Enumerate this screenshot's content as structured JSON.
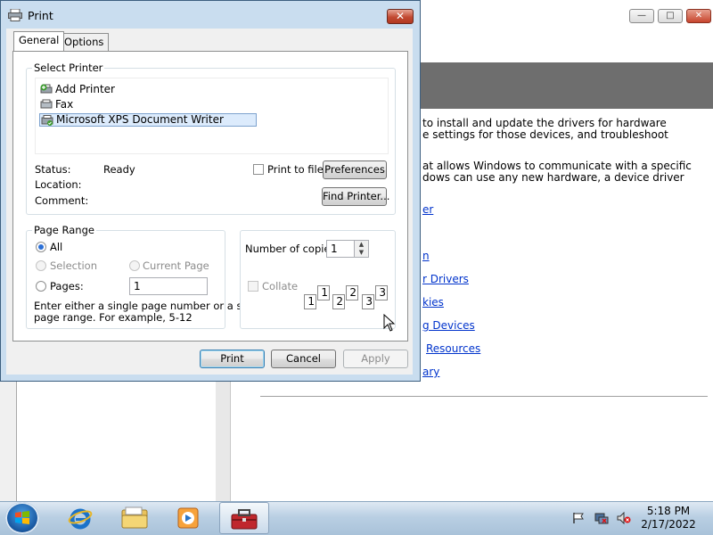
{
  "dialog": {
    "title": "Print",
    "close_glyph": "✕",
    "tabs": [
      {
        "label": "General"
      },
      {
        "label": "Options"
      }
    ],
    "select_printer": {
      "group_title": "Select Printer",
      "printers": [
        {
          "label": "Add Printer",
          "icon": "add-printer-icon"
        },
        {
          "label": "Fax",
          "icon": "fax-icon"
        },
        {
          "label": "Microsoft XPS Document Writer",
          "icon": "printer-icon",
          "selected": true
        }
      ],
      "status_label": "Status:",
      "status_value": "Ready",
      "location_label": "Location:",
      "comment_label": "Comment:",
      "print_to_file_label": "Print to file",
      "preferences_button": "Preferences",
      "find_printer_button": "Find Printer..."
    },
    "page_range": {
      "group_title": "Page Range",
      "all_label": "All",
      "selection_label": "Selection",
      "current_page_label": "Current Page",
      "pages_label": "Pages:",
      "pages_value": "1",
      "hint_line1": "Enter either a single page number or a single",
      "hint_line2": "page range.  For example, 5-12"
    },
    "copies": {
      "label": "Number of copies:",
      "value": "1",
      "collate_label": "Collate",
      "collate_pages": [
        "1",
        "1",
        "2",
        "2",
        "3",
        "3"
      ]
    },
    "buttons": {
      "print": "Print",
      "cancel": "Cancel",
      "apply": "Apply"
    }
  },
  "background_window": {
    "controls": {
      "minimize": "—",
      "maximize": "□",
      "close": "✕"
    },
    "paragraph1_line1": "to install and update the drivers for hardware",
    "paragraph1_line2": "e settings for those devices, and troubleshoot",
    "paragraph2_line1": "at allows Windows to communicate with a specific",
    "paragraph2_line2": "dows can use any new hardware, a device driver",
    "links": [
      "er",
      "n",
      "r Drivers",
      "kies",
      "g Devices",
      "Resources",
      "ary"
    ]
  },
  "taskbar": {
    "time": "5:18 PM",
    "date": "2/17/2022",
    "pinned": [
      {
        "name": "internet-explorer-icon"
      },
      {
        "name": "file-explorer-icon"
      },
      {
        "name": "media-player-icon"
      },
      {
        "name": "toolbox-icon",
        "active": true
      }
    ],
    "tray": [
      "action-center-flag-icon",
      "network-icon",
      "volume-muted-icon"
    ]
  },
  "colors": {
    "dialog_frame": "#c9ddef",
    "selection": "#dcebfc",
    "link": "#0033cc",
    "close_button": "#c24a32"
  }
}
